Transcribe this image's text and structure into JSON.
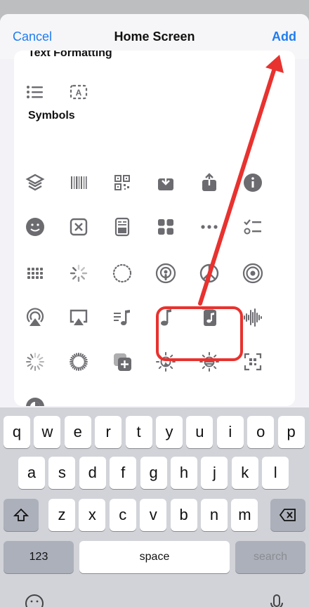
{
  "navbar": {
    "cancel": "Cancel",
    "title": "Home Screen",
    "add": "Add"
  },
  "sections": {
    "previous": "Text Formatting",
    "symbols": "Symbols"
  },
  "icons": [
    "list-bullet-icon",
    "text-format-icon",
    "stack-layers-icon",
    "barcode-icon",
    "qr-code-icon",
    "tray-download-icon",
    "share-icon",
    "info-icon",
    "smiley-icon",
    "xmark-square-icon",
    "id-card-icon",
    "grid-apps-icon",
    "ellipsis-icon",
    "checklist-icon",
    "dots-grid-icon",
    "spinner-icon",
    "dotted-circle-icon",
    "podcast-icon",
    "peace-icon",
    "broadcast-icon",
    "airplay-audio-icon",
    "airplay-video-icon",
    "music-list-icon",
    "music-note-icon",
    "music-file-icon",
    "waveform-icon",
    "loading-rays-icon",
    "loading-ring-icon",
    "add-stack-icon",
    "sun-moon-icon",
    "sun-horizon-icon",
    "qr-scan-icon",
    "contrast-icon"
  ],
  "keyboard": {
    "row1": [
      "q",
      "w",
      "e",
      "r",
      "t",
      "y",
      "u",
      "i",
      "o",
      "p"
    ],
    "row2": [
      "a",
      "s",
      "d",
      "f",
      "g",
      "h",
      "j",
      "k",
      "l"
    ],
    "row3": [
      "z",
      "x",
      "c",
      "v",
      "b",
      "n",
      "m"
    ],
    "numbers": "123",
    "space": "space",
    "search": "search"
  },
  "colors": {
    "accent": "#1f7cf0",
    "annotation": "#e8322f",
    "icon": "#6b6b70"
  }
}
